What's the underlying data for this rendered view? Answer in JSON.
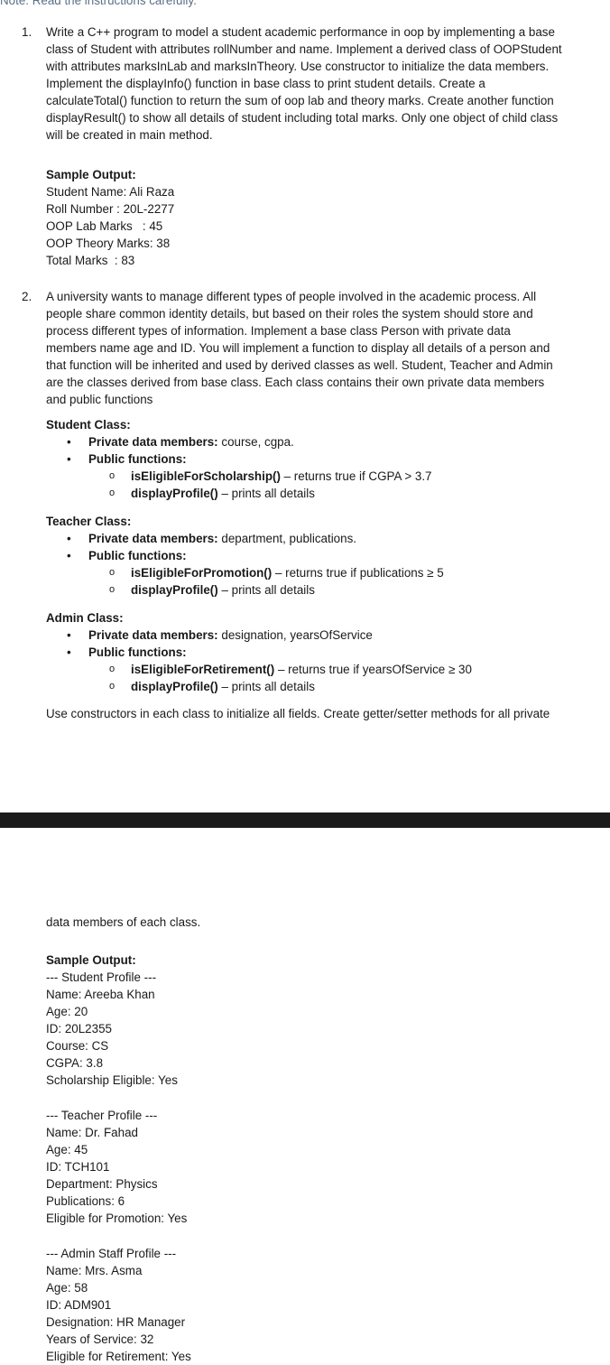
{
  "top_note": "Note: Read the instructions carefully.",
  "q1": {
    "number": "1.",
    "text": "Write a C++ program to model a student academic performance in oop by implementing a base class of Student with attributes rollNumber and name. Implement a derived class of OOPStudent with attributes marksInLab and marksInTheory. Use constructor to initialize the data members. Implement the displayInfo() function in base class to print student details. Create a calculateTotal() function to return the sum of oop lab and theory marks. Create another function displayResult() to show all details of student including total marks. Only one object of child class will be created in main method.",
    "sample_heading": "Sample Output:",
    "sample_lines": [
      "Student Name: Ali Raza",
      "Roll Number : 20L-2277",
      "OOP Lab Marks   : 45",
      "OOP Theory Marks: 38",
      "Total Marks  : 83"
    ]
  },
  "q2": {
    "number": "2.",
    "text": "A university wants to manage different types of people involved in the academic process. All people share common identity details, but based on their roles the system should store and process different types of information. Implement a base class Person with private data members name age and ID. You will implement a function to display all details of a person and that function will be inherited and used by derived classes as well. Student, Teacher and Admin are the classes derived from base class. Each class contains their own private data members and public functions",
    "bullet1": "•",
    "bullet2": "o",
    "student": {
      "heading": "Student Class:",
      "pdm_label": "Private data members:",
      "pdm_value": " course, cgpa.",
      "pf_label": "Public functions:",
      "f1_name": "isEligibleForScholarship()",
      "f1_desc": " – returns true if CGPA > 3.7",
      "f2_name": "displayProfile()",
      "f2_desc": " – prints all details"
    },
    "teacher": {
      "heading": "Teacher Class:",
      "pdm_label": "Private data members:",
      "pdm_value": " department, publications.",
      "pf_label": "Public functions:",
      "f1_name": "isEligibleForPromotion()",
      "f1_desc": " – returns true if publications ≥ 5",
      "f2_name": "displayProfile()",
      "f2_desc": " – prints all details"
    },
    "admin": {
      "heading": "Admin Class:",
      "pdm_label": "Private data members:",
      "pdm_value": " designation, yearsOfService",
      "pf_label": "Public functions:",
      "f1_name": "isEligibleForRetirement()",
      "f1_desc": " – returns true if yearsOfService ≥ 30",
      "f2_name": "displayProfile()",
      "f2_desc": " – prints all details"
    },
    "constructors_text_part1": "Use constructors in each class to initialize all fields. Create getter/setter methods for all private",
    "constructors_text_part2": "data members of each class.",
    "sample_heading": "Sample Output:",
    "sample_groups": [
      [
        "--- Student Profile ---",
        "Name: Areeba Khan",
        "Age: 20",
        "ID: 20L2355",
        "Course: CS",
        "CGPA: 3.8",
        "Scholarship Eligible: Yes"
      ],
      [
        "--- Teacher Profile ---",
        "Name: Dr. Fahad",
        "Age: 45",
        "ID: TCH101",
        "Department: Physics",
        "Publications: 6",
        "Eligible for Promotion: Yes"
      ],
      [
        "--- Admin Staff Profile ---",
        "Name: Mrs. Asma",
        "Age: 58",
        "ID: ADM901",
        "Designation: HR Manager",
        "Years of Service: 32",
        "Eligible for Retirement: Yes"
      ]
    ]
  }
}
